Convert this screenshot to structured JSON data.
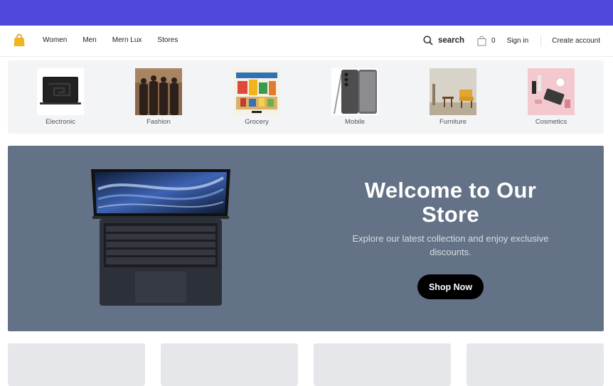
{
  "nav": {
    "links": [
      "Women",
      "Men",
      "Mern Lux",
      "Stores"
    ],
    "search_label": "search",
    "cart_count": "0",
    "sign_in": "Sign in",
    "create_account": "Create account"
  },
  "categories": [
    {
      "label": "Electronic",
      "icon": "laptop-image"
    },
    {
      "label": "Fashion",
      "icon": "fashion-models-image"
    },
    {
      "label": "Grocery",
      "icon": "grocery-poster-image"
    },
    {
      "label": "Mobile",
      "icon": "smartphone-image"
    },
    {
      "label": "Furniture",
      "icon": "armchair-room-image"
    },
    {
      "label": "Cosmetics",
      "icon": "cosmetics-products-image"
    }
  ],
  "hero": {
    "title": "Welcome to Our Store",
    "subtitle": "Explore our latest collection and enjoy exclusive discounts.",
    "button": "Shop Now"
  },
  "colors": {
    "topbar": "#4f46db",
    "hero_bg": "#647287",
    "button_bg": "#000000",
    "category_bg": "#f3f4f6",
    "card_placeholder": "#e5e7eb"
  }
}
